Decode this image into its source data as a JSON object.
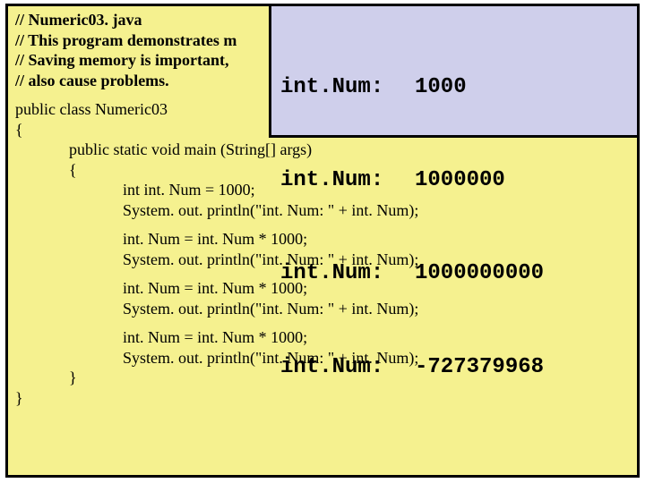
{
  "comments": {
    "c1": "// Numeric03. java",
    "c2": "// This program demonstrates m",
    "c3": "// Saving memory is important,",
    "c4": "// also cause problems."
  },
  "code": {
    "class_decl": "public class Numeric03",
    "open_brace": "{",
    "main_sig": "public static void main (String[] args)",
    "main_open": "{",
    "l1": "int int. Num = 1000;",
    "l2": "System. out. println(\"int. Num: \" + int. Num);",
    "l3": "int. Num = int. Num * 1000;",
    "l4": "System. out. println(\"int. Num: \" + int. Num);",
    "l5": "int. Num = int. Num * 1000;",
    "l6": "System. out. println(\"int. Num: \" + int. Num);",
    "l7": "int. Num = int. Num * 1000;",
    "l8": "System. out. println(\"int. Num: \" + int. Num);",
    "main_close": "}",
    "close_brace": "}"
  },
  "output": {
    "rows": [
      {
        "label": "int.Num:",
        "value": "1000"
      },
      {
        "label": "int.Num:",
        "value": "1000000"
      },
      {
        "label": "int.Num:",
        "value": "1000000000"
      },
      {
        "label": "int.Num:",
        "value": "-727379968"
      }
    ]
  }
}
